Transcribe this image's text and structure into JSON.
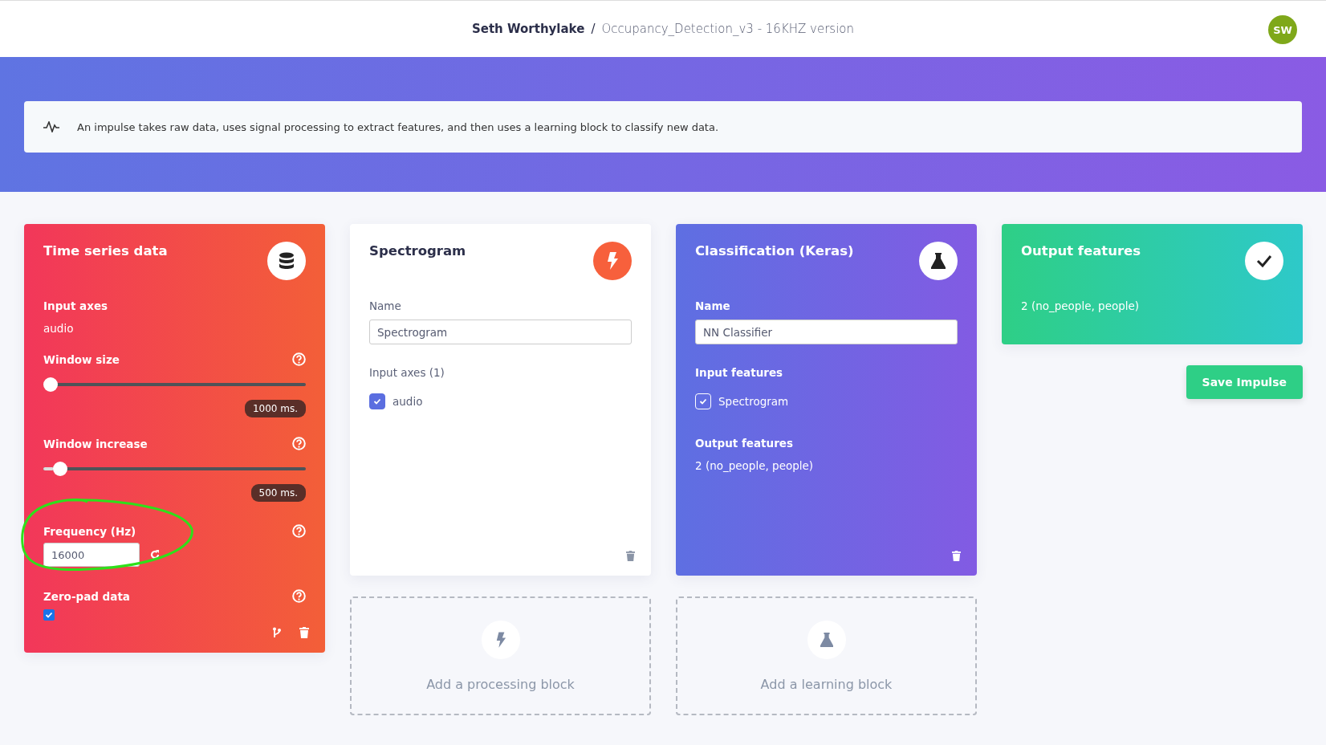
{
  "header": {
    "user": "Seth Worthylake",
    "separator": "/",
    "project": "Occupancy_Detection_v3 - 16KHZ version",
    "avatar": "SW"
  },
  "info": {
    "text": "An impulse takes raw data, uses signal processing to extract features, and then uses a learning block to classify new data."
  },
  "input_block": {
    "title": "Time series data",
    "axes_label": "Input axes",
    "axes_value": "audio",
    "sliders": [
      {
        "label": "Window size",
        "level": 0.0,
        "reading": "1000 ms."
      },
      {
        "label": "Window increase",
        "level": 0.04,
        "reading": "500 ms."
      }
    ],
    "frequency": {
      "label": "Frequency (Hz)",
      "value": "16000"
    },
    "zero_pad": {
      "label": "Zero-pad data",
      "checked": true
    }
  },
  "processing_block": {
    "title": "Spectrogram",
    "name_label": "Name",
    "name_value": "Spectrogram",
    "axes_label": "Input axes (1)",
    "axes": [
      {
        "label": "audio",
        "checked": true
      }
    ]
  },
  "learning_block": {
    "title": "Classification (Keras)",
    "name_label": "Name",
    "name_value": "NN Classifier",
    "features_label": "Input features",
    "features": [
      {
        "label": "Spectrogram",
        "checked": true
      }
    ],
    "output_label": "Output features",
    "output_value": "2 (no_people, people)"
  },
  "output_block": {
    "title": "Output features",
    "value": "2 (no_people, people)"
  },
  "save_button": "Save Impulse",
  "add_processing": "Add a processing block",
  "add_learning": "Add a learning block"
}
